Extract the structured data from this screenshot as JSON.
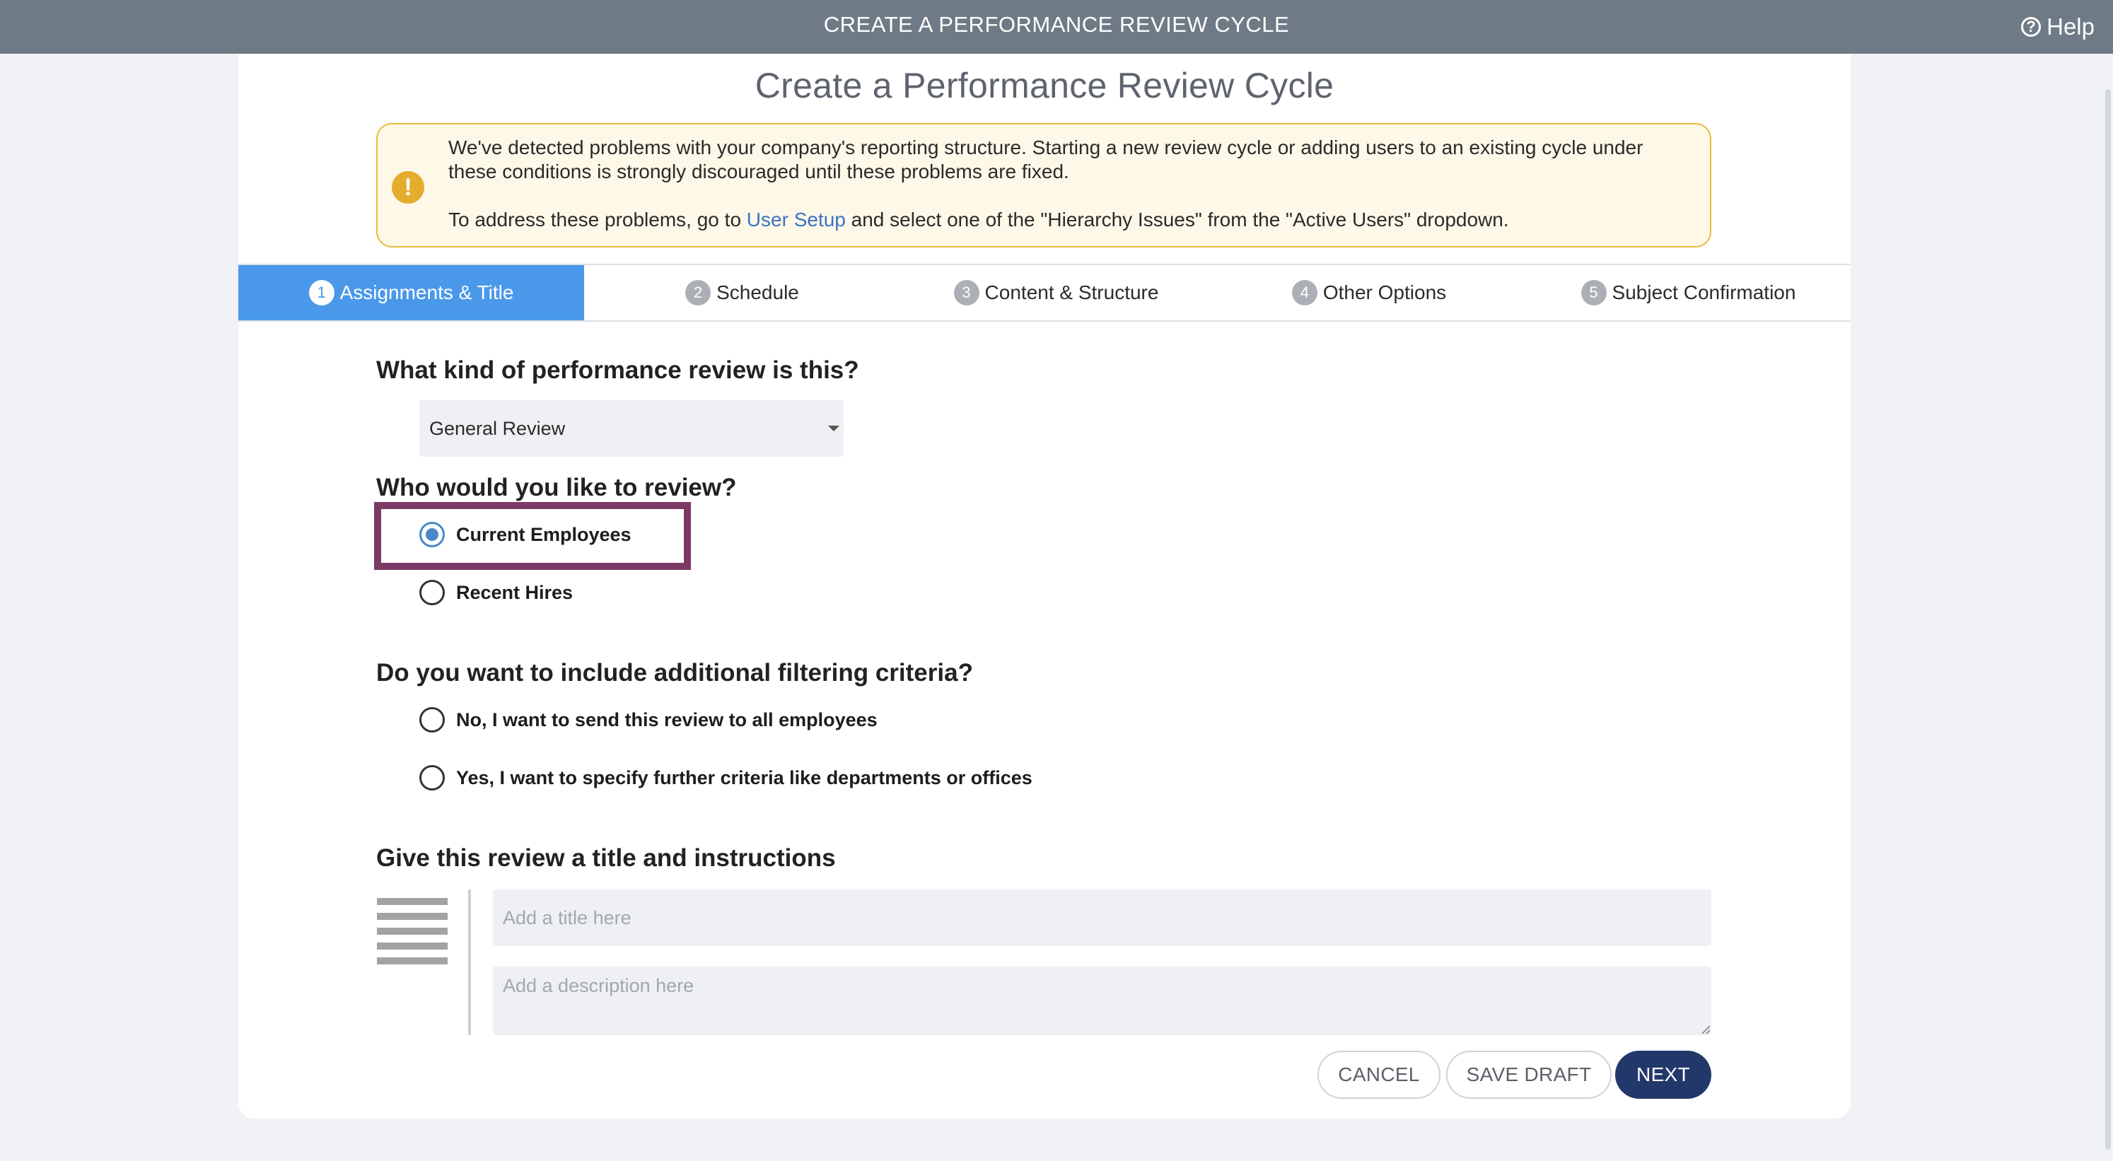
{
  "topbar": {
    "title": "CREATE A PERFORMANCE REVIEW CYCLE",
    "help_label": "Help"
  },
  "page": {
    "title": "Create a Performance Review Cycle"
  },
  "warning": {
    "line1": "We've detected problems with your company's reporting structure. Starting a new review cycle or adding users to an existing cycle under these conditions is strongly discouraged until these problems are fixed.",
    "line2_prefix": "To address these problems, go to ",
    "line2_link": "User Setup",
    "line2_suffix": " and select one of the \"Hierarchy Issues\" from the \"Active Users\" dropdown.",
    "icon": "exclamation-icon"
  },
  "tabs": [
    {
      "num": "1",
      "label": "Assignments & Title",
      "active": true
    },
    {
      "num": "2",
      "label": "Schedule",
      "active": false
    },
    {
      "num": "3",
      "label": "Content & Structure",
      "active": false
    },
    {
      "num": "4",
      "label": "Other Options",
      "active": false
    },
    {
      "num": "5",
      "label": "Subject Confirmation",
      "active": false
    }
  ],
  "review_type": {
    "heading": "What kind of performance review is this?",
    "selected": "General Review"
  },
  "review_target": {
    "heading": "Who would you like to review?",
    "options": [
      {
        "label": "Current Employees",
        "checked": true
      },
      {
        "label": "Recent Hires",
        "checked": false
      }
    ]
  },
  "filtering": {
    "heading": "Do you want to include additional filtering criteria?",
    "options": [
      {
        "label": "No, I want to send this review to all employees",
        "checked": false
      },
      {
        "label": "Yes, I want to specify further criteria like departments or offices",
        "checked": false
      }
    ]
  },
  "title_section": {
    "heading": "Give this review a title and instructions",
    "title_placeholder": "Add a title here",
    "title_value": "",
    "description_placeholder": "Add a description here",
    "description_value": ""
  },
  "actions": {
    "cancel": "CANCEL",
    "save_draft": "SAVE DRAFT",
    "next": "NEXT"
  },
  "colors": {
    "topbar": "#6e7b86",
    "active_tab": "#4a98ea",
    "primary_button": "#23386a",
    "warning_border": "#e7bc3d",
    "highlight": "#7b3a64"
  }
}
